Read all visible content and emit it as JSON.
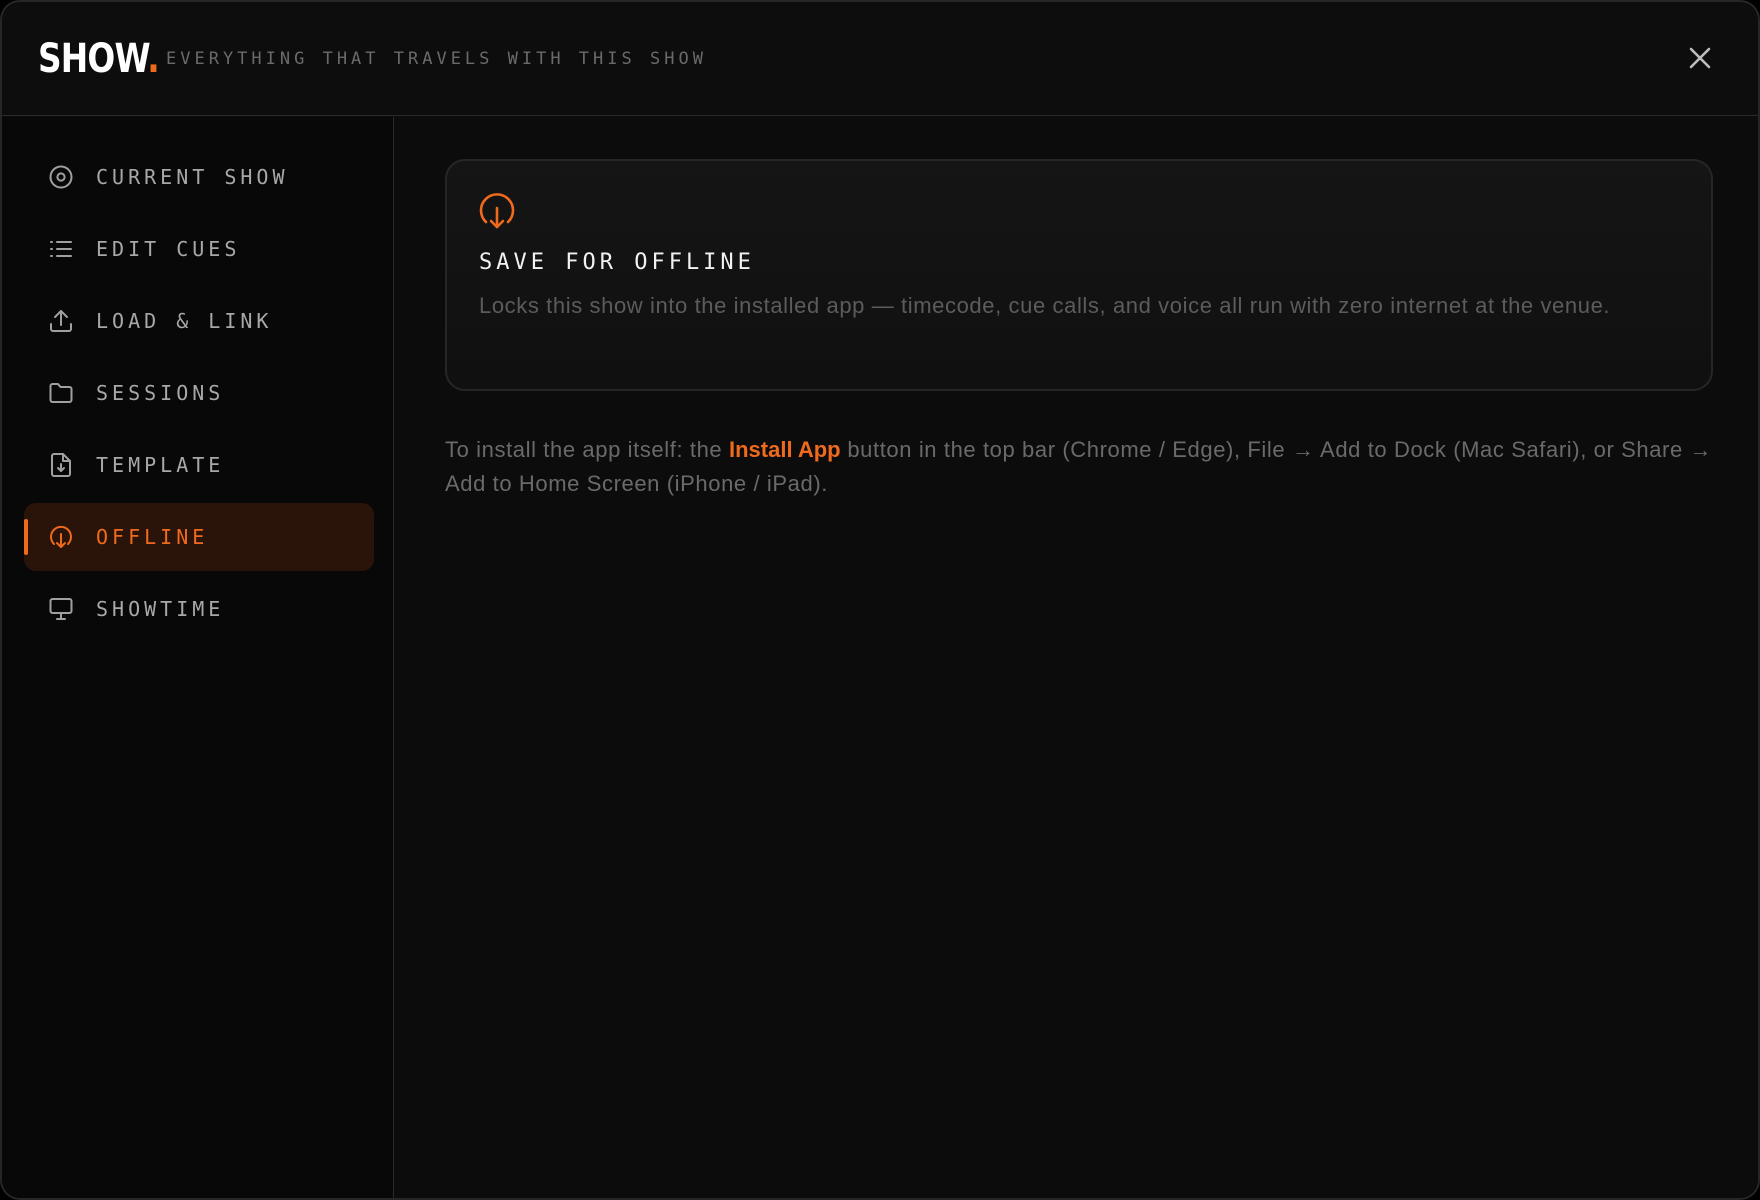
{
  "header": {
    "logo_text": "SHOW",
    "logo_dot": ".",
    "subtitle": "EVERYTHING THAT TRAVELS WITH THIS SHOW",
    "close_icon": "close-icon"
  },
  "sidebar": {
    "items": [
      {
        "label": "CURRENT SHOW",
        "icon": "target-icon",
        "active": false
      },
      {
        "label": "EDIT CUES",
        "icon": "list-icon",
        "active": false
      },
      {
        "label": "LOAD & LINK",
        "icon": "upload-icon",
        "active": false
      },
      {
        "label": "SESSIONS",
        "icon": "folder-icon",
        "active": false
      },
      {
        "label": "TEMPLATE",
        "icon": "file-download-icon",
        "active": false
      },
      {
        "label": "OFFLINE",
        "icon": "offline-download-icon",
        "active": true
      },
      {
        "label": "SHOWTIME",
        "icon": "monitor-icon",
        "active": false
      }
    ]
  },
  "main": {
    "card": {
      "icon": "offline-download-icon",
      "title": "SAVE FOR OFFLINE",
      "description": "Locks this show into the installed app — timecode, cue calls, and voice all run with zero internet at the venue."
    },
    "install_note": {
      "prefix": "To install the app itself: the ",
      "highlight": "Install App",
      "suffix": " button in the top bar (Chrome / Edge), File → Add to Dock (Mac Safari), or Share → Add to Home Screen (iPhone / iPad)."
    }
  },
  "colors": {
    "accent": "#f06a1d",
    "background": "#0c0c0c",
    "sidebar_bg": "#080808",
    "active_bg": "#2a1409",
    "text_muted": "#a8a8a8"
  }
}
